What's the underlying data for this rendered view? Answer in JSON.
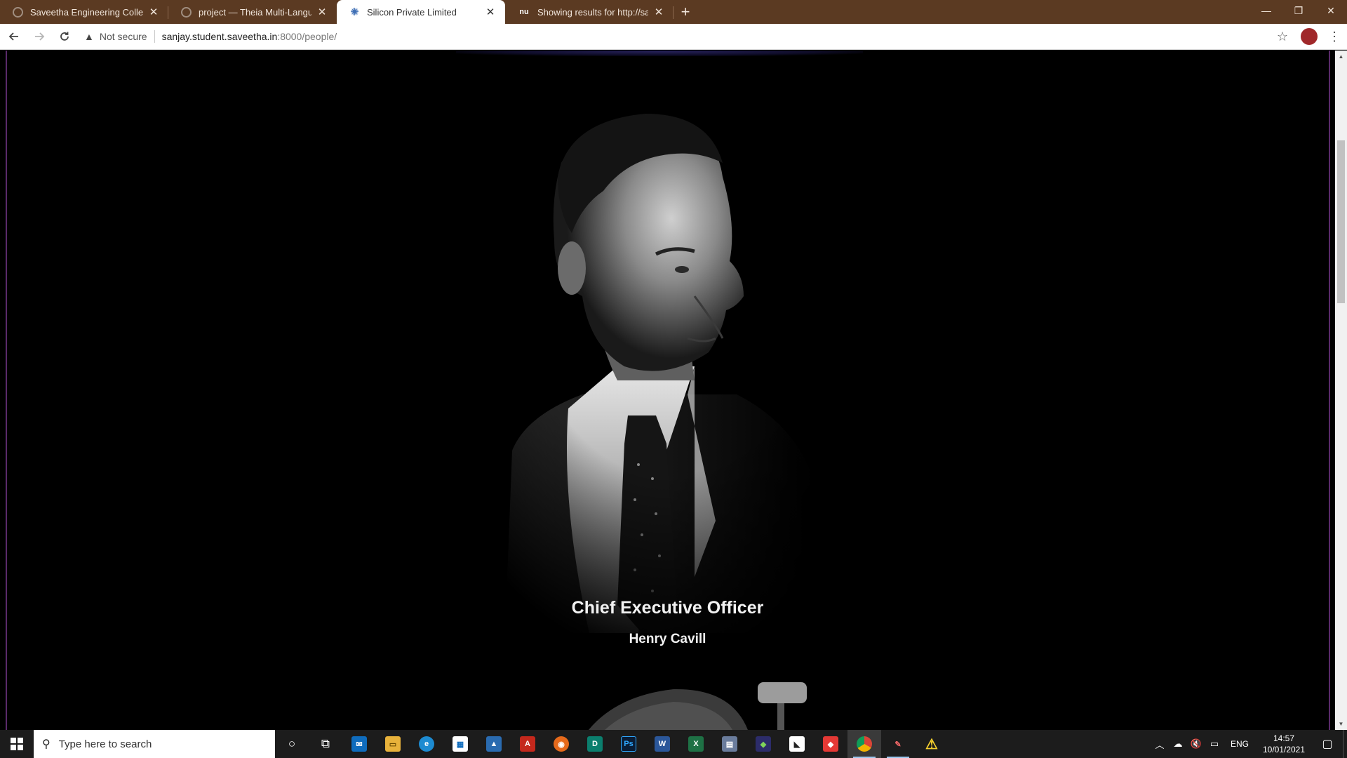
{
  "browser": {
    "tabs": [
      {
        "title": "Saveetha Engineering College",
        "favicon": "globe-icon",
        "active": false
      },
      {
        "title": "project — Theia Multi-Language",
        "favicon": "globe-icon",
        "active": false
      },
      {
        "title": "Silicon Private Limited",
        "favicon": "gear-icon",
        "active": true
      },
      {
        "title": "Showing results for http://sanjay",
        "favicon": "nu-icon",
        "nu_label": "nu",
        "active": false
      }
    ],
    "new_tab_label": "+",
    "address": {
      "security_label": "Not secure",
      "host": "sanjay.student.saveetha.in",
      "rest": ":8000/people/"
    }
  },
  "page": {
    "role": "Chief Executive Officer",
    "name": "Henry Cavill"
  },
  "taskbar": {
    "search_placeholder": "Type here to search",
    "apps": [
      "cortana-icon",
      "task-view-icon",
      "mail-icon",
      "file-explorer-icon",
      "edge-icon",
      "store-icon",
      "photos-icon",
      "acrobat-icon",
      "firefox-icon",
      "dreamweaver-icon",
      "photoshop-icon",
      "word-icon",
      "excel-icon",
      "calculator-icon",
      "app-icon",
      "app-icon",
      "anydesk-icon",
      "chrome-icon",
      "app-icon",
      "warning-icon"
    ],
    "photoshop_label": "Ps",
    "word_label": "W",
    "excel_label": "X",
    "language": "ENG",
    "time": "14:57",
    "date": "10/01/2021"
  },
  "colors": {
    "tab_strip": "#5b3a22",
    "page_background": "#000000",
    "page_border": "#5a2a6a",
    "heading_text": "#f2f2f2"
  }
}
